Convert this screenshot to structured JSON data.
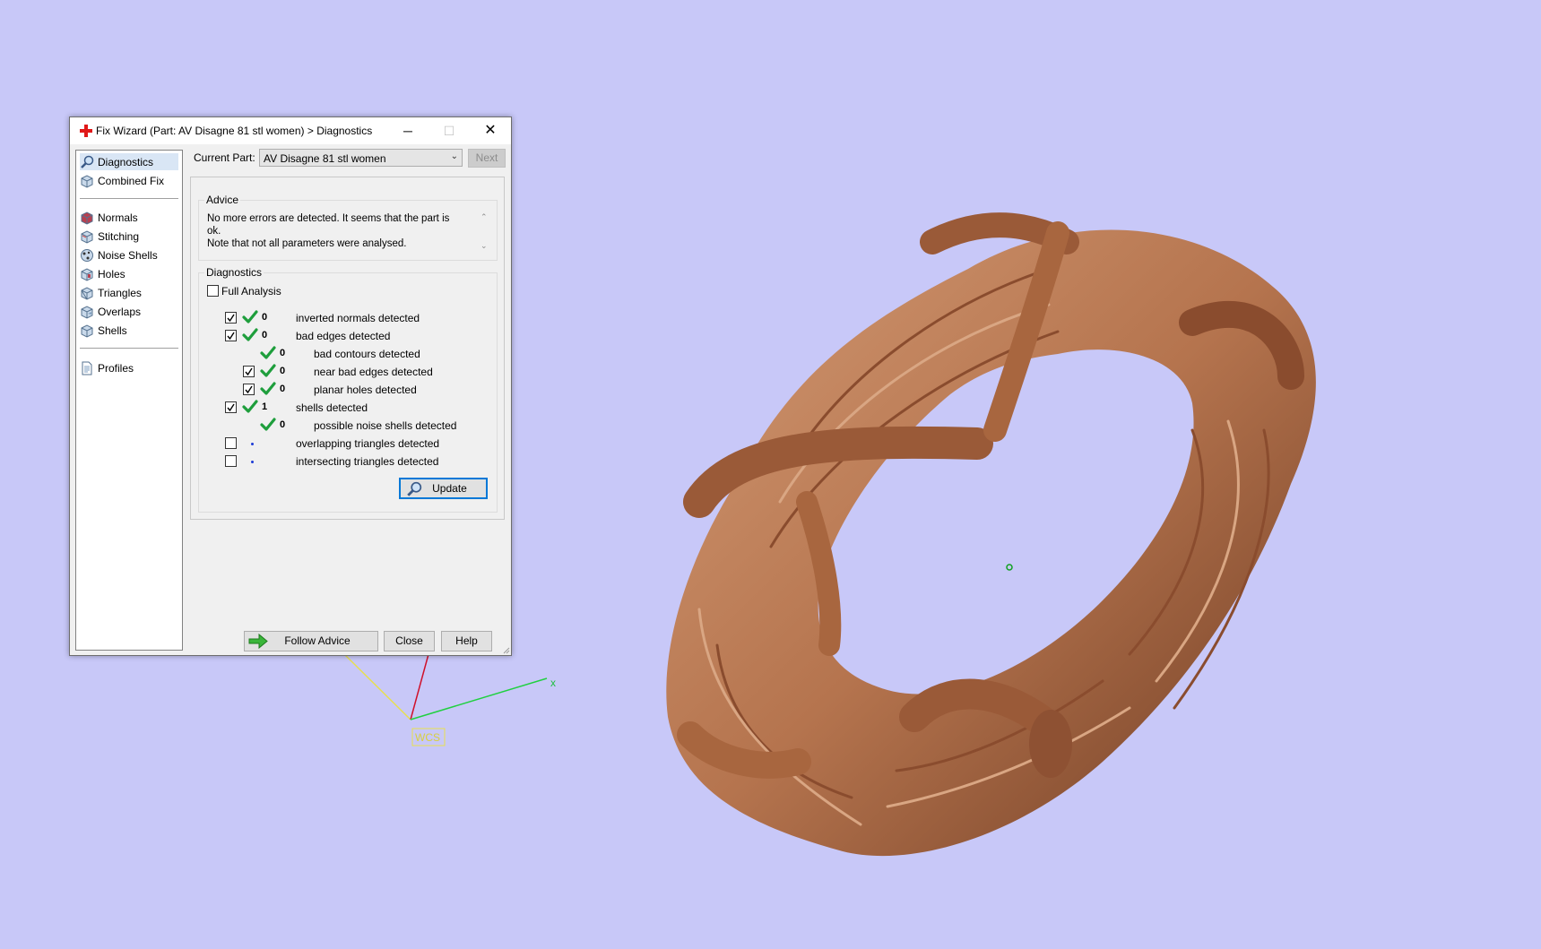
{
  "window": {
    "title": "Fix Wizard (Part: AV Disagne 81 stl women) > Diagnostics",
    "controls": {
      "minimize": "─",
      "maximize": "☐",
      "close": "✕"
    }
  },
  "nav": {
    "top_items": [
      {
        "label": "Diagnostics",
        "icon": "magnifier-icon",
        "selected": true
      },
      {
        "label": "Combined Fix",
        "icon": "cube-icon",
        "selected": false
      }
    ],
    "fix_items": [
      {
        "label": "Normals",
        "icon": "normals-cube-icon"
      },
      {
        "label": "Stitching",
        "icon": "stitching-cube-icon"
      },
      {
        "label": "Noise Shells",
        "icon": "noise-shells-icon"
      },
      {
        "label": "Holes",
        "icon": "holes-cube-icon"
      },
      {
        "label": "Triangles",
        "icon": "triangles-cube-icon"
      },
      {
        "label": "Overlaps",
        "icon": "overlaps-cube-icon"
      },
      {
        "label": "Shells",
        "icon": "shells-cube-icon"
      }
    ],
    "bottom_items": [
      {
        "label": "Profiles",
        "icon": "document-icon"
      }
    ]
  },
  "current_part": {
    "label": "Current Part:",
    "value": "AV Disagne 81 stl women",
    "next_label": "Next"
  },
  "advice": {
    "title": "Advice",
    "text_line1": "No more errors are detected. It seems that the part is ok.",
    "text_line2": "Note that not all parameters were analysed."
  },
  "diagnostics": {
    "title": "Diagnostics",
    "full_analysis_label": "Full Analysis",
    "full_analysis_checked": false,
    "rows": [
      {
        "checked": true,
        "ok": true,
        "count": "0",
        "label": "inverted normals detected",
        "indent": 0,
        "has_checkbox": true
      },
      {
        "checked": true,
        "ok": true,
        "count": "0",
        "label": "bad edges detected",
        "indent": 0,
        "has_checkbox": true
      },
      {
        "checked": false,
        "ok": true,
        "count": "0",
        "label": "bad contours detected",
        "indent": 1,
        "has_checkbox": false
      },
      {
        "checked": true,
        "ok": true,
        "count": "0",
        "label": "near bad edges detected",
        "indent": 1,
        "has_checkbox": true
      },
      {
        "checked": true,
        "ok": true,
        "count": "0",
        "label": "planar holes detected",
        "indent": 1,
        "has_checkbox": true
      },
      {
        "checked": true,
        "ok": true,
        "count": "1",
        "label": "shells detected",
        "indent": 0,
        "has_checkbox": true
      },
      {
        "checked": false,
        "ok": true,
        "count": "0",
        "label": "possible noise shells detected",
        "indent": 1,
        "has_checkbox": false
      },
      {
        "checked": false,
        "ok": false,
        "count": "",
        "label": "overlapping triangles detected",
        "indent": 0,
        "has_checkbox": true
      },
      {
        "checked": false,
        "ok": false,
        "count": "",
        "label": "intersecting triangles detected",
        "indent": 0,
        "has_checkbox": true
      }
    ],
    "update_label": "Update"
  },
  "footer": {
    "follow_advice_label": "Follow Advice",
    "close_label": "Close",
    "help_label": "Help"
  },
  "scene": {
    "axis_x_label": "x",
    "wcs_label": "WCS",
    "background": "#c8c8f8",
    "model_color": "#b87a55"
  }
}
